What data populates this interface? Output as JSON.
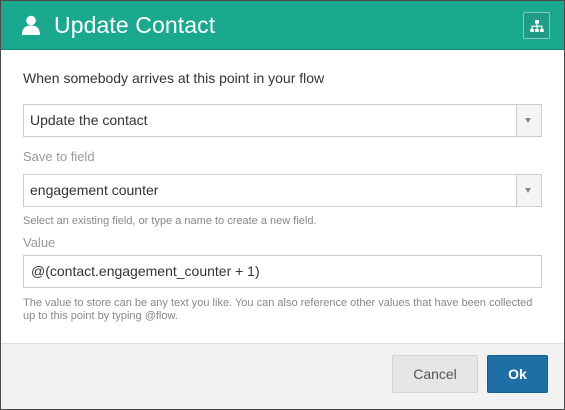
{
  "header": {
    "title": "Update Contact",
    "person_icon": "person-icon",
    "flow_icon": "sitemap-icon",
    "bg_color": "#1aa88e"
  },
  "form": {
    "prompt": "When somebody arrives at this point in your flow",
    "action_select": {
      "value": "Update the contact"
    },
    "field_label": "Save to field",
    "field_select": {
      "value": "engagement counter"
    },
    "field_help": "Select an existing field, or type a name to create a new field.",
    "value_label": "Value",
    "value_input": {
      "value": "@(contact.engagement_counter + 1)"
    },
    "value_help": "The value to store can be any text you like. You can also reference other values that have been collected up to this point by typing @flow."
  },
  "footer": {
    "cancel_label": "Cancel",
    "ok_label": "Ok",
    "ok_color": "#1e6fa3"
  }
}
